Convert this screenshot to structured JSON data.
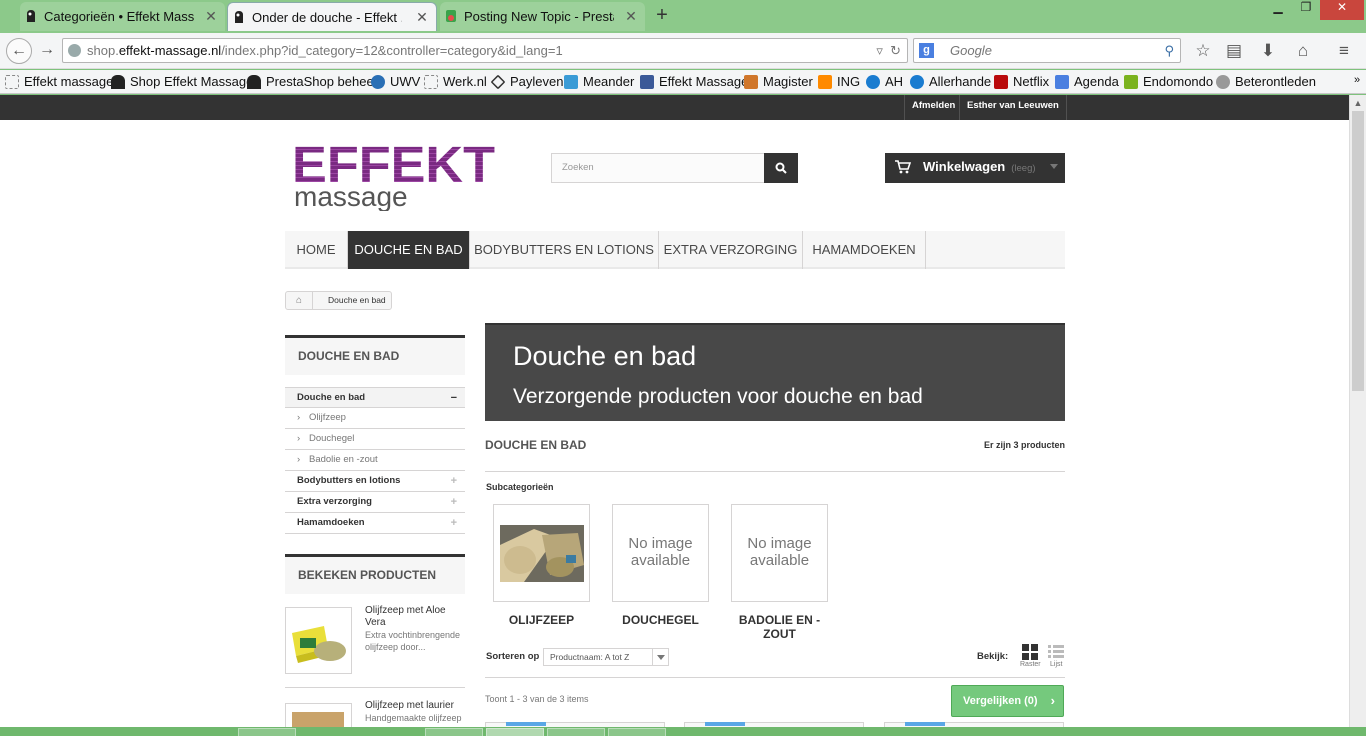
{
  "browser": {
    "tabs": [
      {
        "label": "Categorieën • Effekt Massa..."
      },
      {
        "label": "Onder de douche - Effekt ..."
      },
      {
        "label": "Posting New Topic - Presta..."
      }
    ],
    "url_prefix": "shop.",
    "url_domain": "effekt-massage.nl",
    "url_path": "/index.php?id_category=12&controller=category&id_lang=1",
    "search_placeholder": "Google",
    "bookmarks": [
      {
        "label": "Effekt massage"
      },
      {
        "label": "Shop Effekt Massage"
      },
      {
        "label": "PrestaShop beheer"
      },
      {
        "label": "UWV"
      },
      {
        "label": "Werk.nl"
      },
      {
        "label": "Payleven"
      },
      {
        "label": "Meander"
      },
      {
        "label": "Effekt Massage"
      },
      {
        "label": "Magister"
      },
      {
        "label": "ING"
      },
      {
        "label": "AH"
      },
      {
        "label": "Allerhande"
      },
      {
        "label": "Netflix"
      },
      {
        "label": "Agenda"
      },
      {
        "label": "Endomondo"
      },
      {
        "label": "Beterontleden"
      }
    ]
  },
  "header": {
    "top_links": [
      "Afmelden",
      "Esther van Leeuwen"
    ],
    "logo_top": "EFFEKT",
    "logo_bottom": "massage",
    "search_placeholder": "Zoeken",
    "cart_label": "Winkelwagen",
    "cart_status": "(leeg)"
  },
  "menu": {
    "items": [
      {
        "label": "HOME"
      },
      {
        "label": "DOUCHE EN BAD"
      },
      {
        "label": "BODYBUTTERS EN LOTIONS"
      },
      {
        "label": "EXTRA VERZORGING"
      },
      {
        "label": "HAMAMDOEKEN"
      }
    ]
  },
  "breadcrumb": {
    "current": "Douche en bad"
  },
  "sidebar": {
    "categories_title": "DOUCHE EN BAD",
    "categories": [
      {
        "label": "Douche en bad",
        "toggle": "−"
      },
      {
        "label": "Olijfzeep"
      },
      {
        "label": "Douchegel"
      },
      {
        "label": "Badolie en -zout"
      },
      {
        "label": "Bodybutters en lotions",
        "toggle": "+"
      },
      {
        "label": "Extra verzorging",
        "toggle": "+"
      },
      {
        "label": "Hamamdoeken",
        "toggle": "+"
      }
    ],
    "viewed_title": "BEKEKEN PRODUCTEN",
    "viewed": [
      {
        "name": "Olijfzeep met Aloe Vera",
        "desc": "Extra vochtinbrengende olijfzeep door..."
      },
      {
        "name": "Olijfzeep met laurier",
        "desc": "Handgemaakte olijfzeep"
      }
    ]
  },
  "main": {
    "hero_title": "Douche en bad",
    "hero_subtitle": "Verzorgende producten voor douche en bad",
    "section_title": "DOUCHE EN BAD",
    "product_count": "Er zijn 3 producten",
    "subcategories_label": "Subcategorieën",
    "subcategories": [
      {
        "name": "OLIJFZEEP",
        "noimage": ""
      },
      {
        "name": "DOUCHEGEL",
        "noimage": "No image available"
      },
      {
        "name": "BADOLIE EN -ZOUT",
        "noimage": "No image available"
      }
    ],
    "sort_label": "Sorteren op",
    "sort_value": "Productnaam: A tot Z",
    "view_label": "Bekijk:",
    "view_grid": "Raster",
    "view_list": "Lijst",
    "showing": "Toont 1 - 3 van de 3 items",
    "compare_label": "Vergelijken (0)"
  },
  "colors": {
    "logo_purple": "#7a2a82",
    "dark": "#333333",
    "compare_green": "#75c97d",
    "chrome_green": "#8cc98a"
  }
}
